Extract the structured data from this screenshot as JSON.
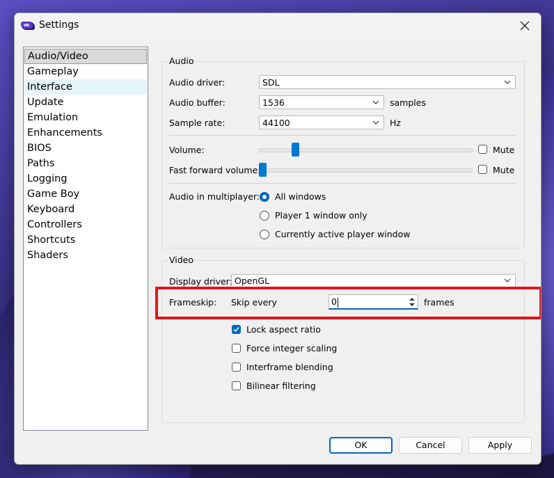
{
  "window": {
    "title": "Settings",
    "app_icon": "gameboy-advance-icon",
    "close_icon": "close-icon"
  },
  "sidebar": {
    "items": [
      {
        "label": "Audio/Video",
        "state": "selected"
      },
      {
        "label": "Gameplay",
        "state": ""
      },
      {
        "label": "Interface",
        "state": "hover"
      },
      {
        "label": "Update",
        "state": ""
      },
      {
        "label": "Emulation",
        "state": ""
      },
      {
        "label": "Enhancements",
        "state": ""
      },
      {
        "label": "BIOS",
        "state": ""
      },
      {
        "label": "Paths",
        "state": ""
      },
      {
        "label": "Logging",
        "state": ""
      },
      {
        "label": "Game Boy",
        "state": ""
      },
      {
        "label": "Keyboard",
        "state": ""
      },
      {
        "label": "Controllers",
        "state": ""
      },
      {
        "label": "Shortcuts",
        "state": ""
      },
      {
        "label": "Shaders",
        "state": ""
      }
    ]
  },
  "audio": {
    "group_title": "Audio",
    "driver_label": "Audio driver:",
    "driver_value": "SDL",
    "buffer_label": "Audio buffer:",
    "buffer_value": "1536",
    "buffer_unit": "samples",
    "rate_label": "Sample rate:",
    "rate_value": "44100",
    "rate_unit": "Hz",
    "volume_label": "Volume:",
    "volume_level": 0.16,
    "volume_mute_label": "Mute",
    "volume_mute_checked": false,
    "ff_volume_label": "Fast forward volume:",
    "ff_volume_level": 0.0,
    "ff_mute_label": "Mute",
    "ff_mute_checked": false,
    "multiplayer_label": "Audio in multiplayer:",
    "multiplayer_options": [
      {
        "label": "All windows",
        "checked": true
      },
      {
        "label": "Player 1 window only",
        "checked": false
      },
      {
        "label": "Currently active player window",
        "checked": false
      }
    ]
  },
  "video": {
    "group_title": "Video",
    "display_driver_label": "Display driver:",
    "display_driver_value": "OpenGL",
    "frameskip_label": "Frameskip:",
    "skip_every_label": "Skip every",
    "frameskip_value": "0",
    "frames_unit": "frames",
    "checkboxes": [
      {
        "label": "Lock aspect ratio",
        "checked": true
      },
      {
        "label": "Force integer scaling",
        "checked": false
      },
      {
        "label": "Interframe blending",
        "checked": false
      },
      {
        "label": "Bilinear filtering",
        "checked": false
      }
    ]
  },
  "buttons": {
    "ok": "OK",
    "cancel": "Cancel",
    "apply": "Apply"
  },
  "colors": {
    "accent": "#0067c0",
    "highlight_box": "#e3151a"
  }
}
